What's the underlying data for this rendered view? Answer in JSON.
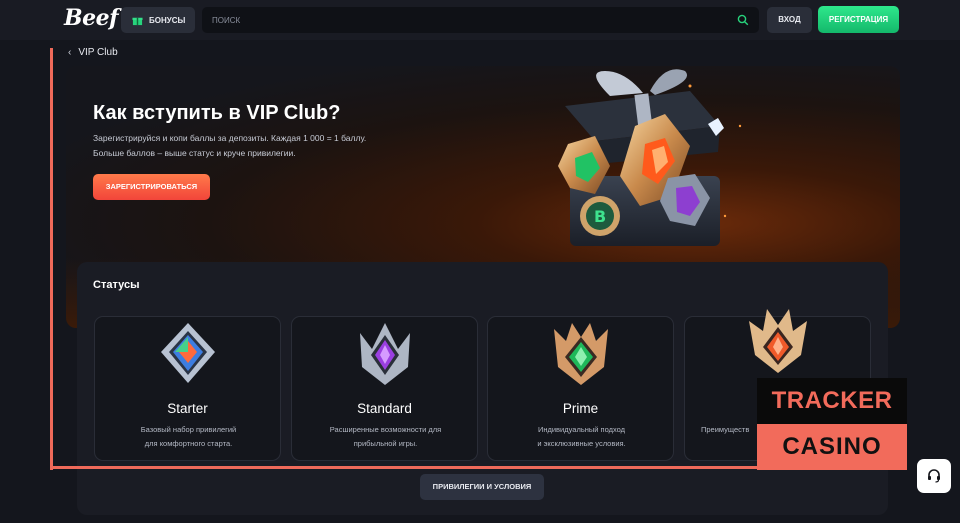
{
  "header": {
    "logo": "Beef",
    "bonus_label": "БОНУСЫ",
    "search_placeholder": "ПОИСК",
    "login_label": "ВХОД",
    "register_label": "РЕГИСТРАЦИЯ"
  },
  "breadcrumb": {
    "label": "VIP Club"
  },
  "hero": {
    "title": "Как вступить в VIP Club?",
    "description_line1": "Зарегистрируйся и копи баллы за депозиты. Каждая 1 000     = 1 баллу.",
    "description_line2": "Больше баллов – выше статус и круче привилегии.",
    "button_label": "ЗАРЕГИСТРИРОВАТЬСЯ"
  },
  "statuses": {
    "title": "Статусы",
    "cards": [
      {
        "name": "Starter",
        "desc_line1": "Базовый набор привилегий",
        "desc_line2": "для комфортного старта."
      },
      {
        "name": "Standard",
        "desc_line1": "Расширенные возможности для",
        "desc_line2": "прибыльной игры."
      },
      {
        "name": "Prime",
        "desc_line1": "Индивидуальный подход",
        "desc_line2": "и эксклюзивные условия."
      },
      {
        "name": "",
        "desc_line1": "Преимуществ",
        "desc_line2": ""
      }
    ],
    "privileges_button": "ПРИВИЛЕГИИ И УСЛОВИЯ"
  },
  "watermark": {
    "line1": "TRACKER",
    "line2": "CASINO"
  },
  "colors": {
    "accent_green": "#1fcf7a",
    "accent_orange": "#f2553e",
    "watermark": "#f26b5b"
  }
}
